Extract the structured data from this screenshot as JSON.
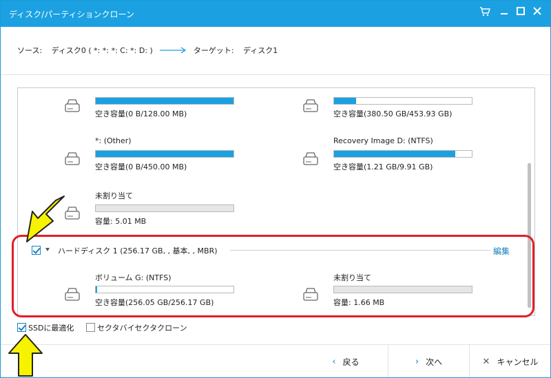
{
  "window": {
    "title": "ディスク/パーティションクローン"
  },
  "titlebar_icons": [
    "cart-icon",
    "minimize-icon",
    "maximize-icon",
    "close-icon"
  ],
  "source_row": {
    "source_label": "ソース:",
    "source_value": "ディスク0 ( *: *: *: C: *: D: )",
    "target_label": "ターゲット:",
    "target_value": "ディスク1"
  },
  "partitions_disk0": [
    {
      "name": "",
      "capacity": "空き容量(0 B/128.00 MB)",
      "used_fraction": 1.0
    },
    {
      "name": "",
      "capacity": "空き容量(380.50 GB/453.93 GB)",
      "used_fraction": 0.16
    },
    {
      "name": "*: (Other)",
      "capacity": "空き容量(0 B/450.00 MB)",
      "used_fraction": 1.0
    },
    {
      "name": "Recovery Image D: (NTFS)",
      "capacity": "空き容量(1.21 GB/9.91 GB)",
      "used_fraction": 0.88
    },
    {
      "name": "未割り当て",
      "capacity": "容量: 5.01 MB",
      "used_fraction": 0.0
    }
  ],
  "disk1": {
    "label": "ハードディスク 1 (256.17 GB, , 基本, , MBR)",
    "edit_label": "編集",
    "checked": true,
    "partitions": [
      {
        "name": "ボリューム G: (NTFS)",
        "capacity": "空き容量(256.05 GB/256.17 GB)",
        "used_fraction": 0.0
      },
      {
        "name": "未割り当て",
        "capacity": "容量: 1.66 MB",
        "used_fraction": 0.0
      }
    ]
  },
  "options": {
    "ssd_label": "SSDに最適化",
    "ssd_checked": true,
    "sector_label": "セクタバイセクタクローン",
    "sector_checked": false
  },
  "footer": {
    "back_label": "戻る",
    "next_label": "次へ",
    "cancel_label": "キャンセル"
  },
  "colors": {
    "accent": "#1ba1e2",
    "highlight": "#e21d2a",
    "arrow_yellow": "#f7f200"
  }
}
